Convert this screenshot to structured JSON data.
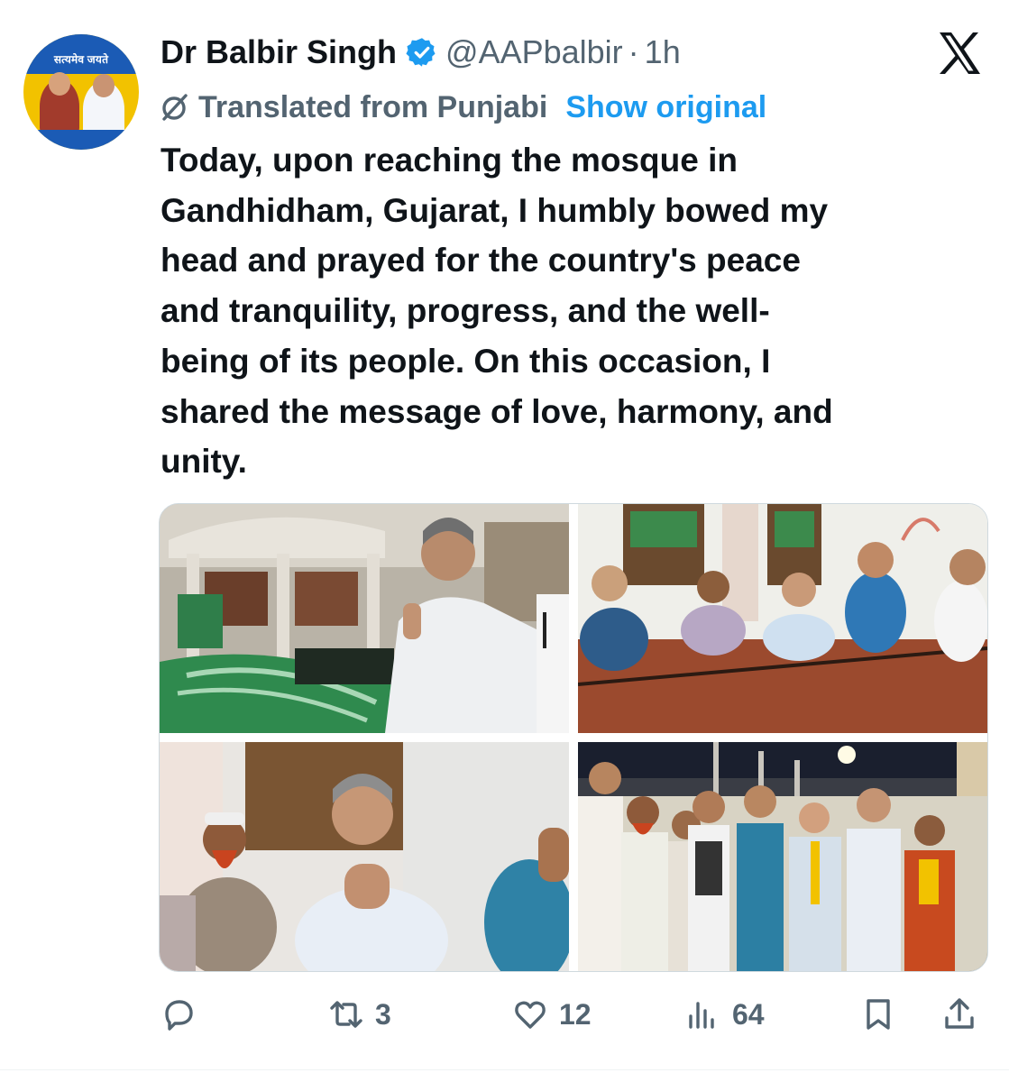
{
  "author": {
    "display_name": "Dr Balbir Singh",
    "handle": "@AAPbalbir",
    "separator": "·",
    "time": "1h",
    "avatar_motto": "सत्यमेव जयते"
  },
  "translation": {
    "label": "Translated from Punjabi",
    "show_original": "Show original"
  },
  "tweet": {
    "lines": [
      "Today, upon reaching the mosque in",
      "Gandhidham, Gujarat, I humbly bowed my",
      "head and prayed for the country's peace",
      "and tranquility, progress, and the well-",
      "being of its people. On this occasion, I",
      "shared the message of love, harmony, and",
      "unity."
    ]
  },
  "actions": {
    "reply_count": "",
    "retweet_count": "3",
    "like_count": "12",
    "view_count": "64"
  },
  "colors": {
    "text": "#0f1419",
    "secondary": "#536471",
    "accent": "#1d9bf0",
    "border": "#cfd9de"
  },
  "icons": {
    "verified": "verified-badge-icon",
    "x_logo": "x-logo-icon",
    "translate": "translate-icon",
    "reply": "reply-icon",
    "retweet": "retweet-icon",
    "like": "heart-icon",
    "views": "views-icon",
    "bookmark": "bookmark-icon",
    "share": "share-icon"
  }
}
